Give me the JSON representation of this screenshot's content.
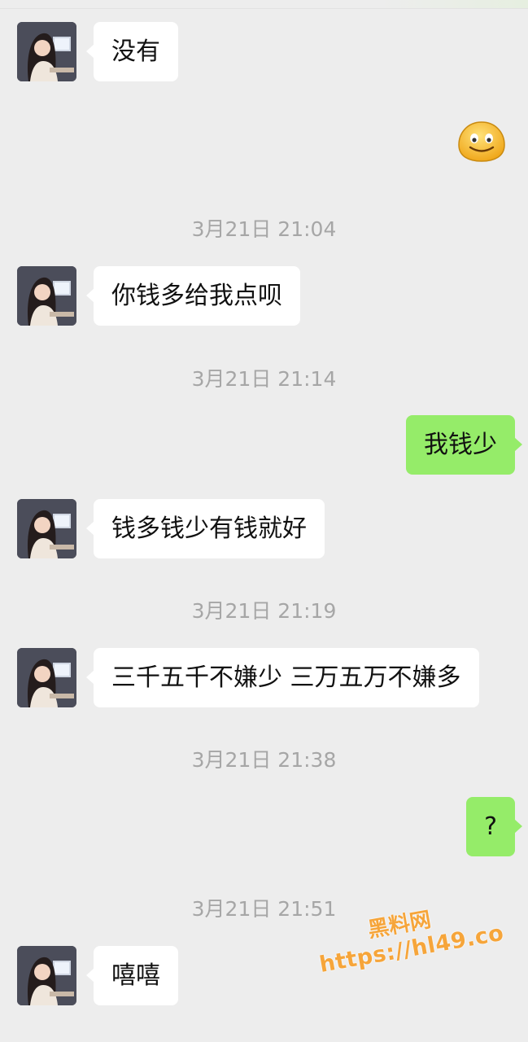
{
  "chat": {
    "messages": [
      {
        "type": "received",
        "text": "没有"
      },
      {
        "type": "sent_emoji",
        "icon": "smile-emoji"
      },
      {
        "type": "timestamp",
        "text": "3月21日 21:04"
      },
      {
        "type": "received",
        "text": "你钱多给我点呗"
      },
      {
        "type": "timestamp",
        "text": "3月21日 21:14"
      },
      {
        "type": "sent",
        "text": "我钱少"
      },
      {
        "type": "received",
        "text": "钱多钱少有钱就好"
      },
      {
        "type": "timestamp",
        "text": "3月21日 21:19"
      },
      {
        "type": "received",
        "text": "三千五千不嫌少 三万五万不嫌多"
      },
      {
        "type": "timestamp",
        "text": "3月21日 21:38"
      },
      {
        "type": "sent",
        "text": "?"
      },
      {
        "type": "timestamp",
        "text": "3月21日 21:51"
      },
      {
        "type": "received",
        "text": "嘻嘻"
      }
    ]
  },
  "watermark": {
    "title": "黑料网",
    "url": "https://hl49.co"
  },
  "colors": {
    "background": "#ededed",
    "received_bubble": "#ffffff",
    "sent_bubble": "#95ec69",
    "timestamp_text": "#a6a6a6",
    "watermark": "#f6a53a"
  }
}
